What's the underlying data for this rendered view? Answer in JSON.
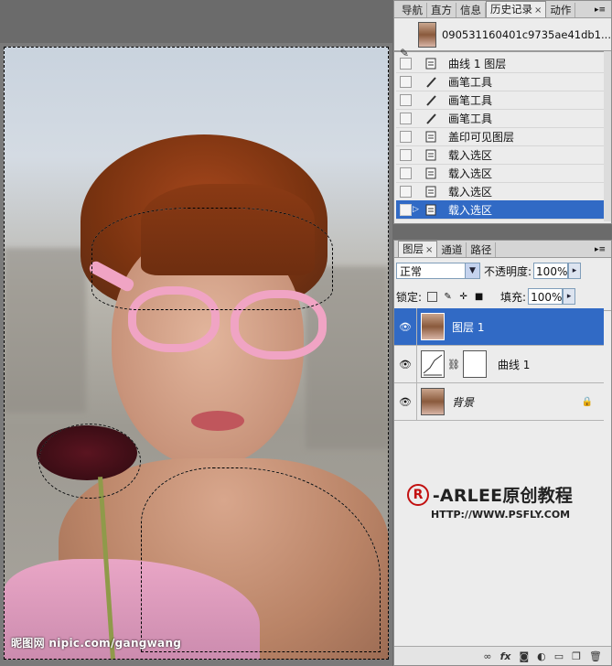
{
  "history_panel": {
    "tabs": [
      "导航",
      "直方",
      "信息",
      "历史记录",
      "动作"
    ],
    "active_tab": "历史记录",
    "snapshot_name": "090531160401c9735ae41db1...",
    "items": [
      {
        "label": "曲线 1 图层",
        "icon": "layer-icon"
      },
      {
        "label": "画笔工具",
        "icon": "brush-icon"
      },
      {
        "label": "画笔工具",
        "icon": "brush-icon"
      },
      {
        "label": "画笔工具",
        "icon": "brush-icon"
      },
      {
        "label": "盖印可见图层",
        "icon": "layer-icon"
      },
      {
        "label": "载入选区",
        "icon": "layer-icon"
      },
      {
        "label": "载入选区",
        "icon": "layer-icon"
      },
      {
        "label": "载入选区",
        "icon": "layer-icon"
      },
      {
        "label": "载入选区",
        "icon": "layer-icon",
        "selected": true
      }
    ]
  },
  "layers_panel": {
    "tabs": [
      "图层",
      "通道",
      "路径"
    ],
    "active_tab": "图层",
    "blend_mode": "正常",
    "opacity_label": "不透明度:",
    "opacity_value": "100%",
    "lock_label": "锁定:",
    "fill_label": "填充:",
    "fill_value": "100%",
    "layers": [
      {
        "name": "图层 1",
        "selected": true
      },
      {
        "name": "曲线 1"
      },
      {
        "name": "背景",
        "locked": true
      }
    ]
  },
  "watermark": {
    "symbol": "R",
    "title": "-ARLEE原创教程",
    "url": "HTTP://WWW.PSFLY.COM"
  },
  "canvas_credit": "昵图网 nipic.com/gangwang",
  "colors": {
    "selection_blue": "#316ac5",
    "watermark_red": "#c21010"
  }
}
